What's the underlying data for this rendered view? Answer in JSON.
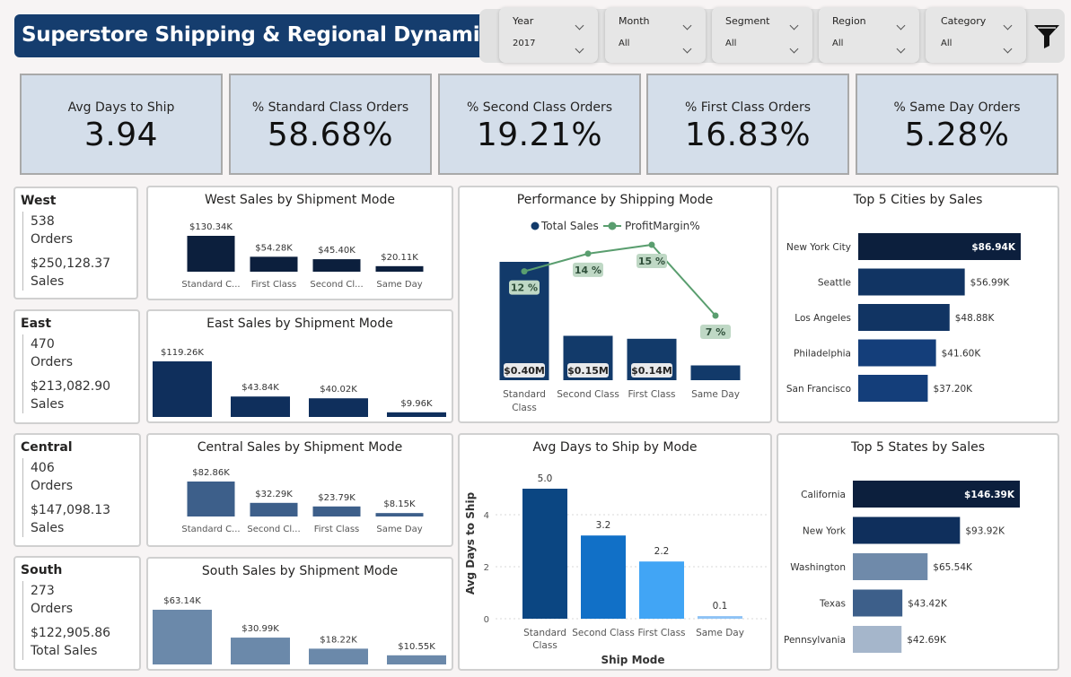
{
  "header": {
    "title": "Superstore Shipping & Regional Dynamics"
  },
  "slicers": [
    {
      "label": "Year",
      "value": "2017"
    },
    {
      "label": "Month",
      "value": "All"
    },
    {
      "label": "Segment",
      "value": "All"
    },
    {
      "label": "Region",
      "value": "All"
    },
    {
      "label": "Category",
      "value": "All"
    }
  ],
  "icons": {
    "filter": "funnel-icon"
  },
  "kpis": [
    {
      "label": "Avg Days to Ship",
      "value": "3.94"
    },
    {
      "label": "% Standard Class Orders",
      "value": "58.68%"
    },
    {
      "label": "% Second Class Orders",
      "value": "19.21%"
    },
    {
      "label": "% First Class Orders",
      "value": "16.83%"
    },
    {
      "label": "% Same Day Orders",
      "value": "5.28%"
    }
  ],
  "regions": [
    {
      "name": "West",
      "orders": "538",
      "orders_label": "Orders",
      "sales": "$250,128.37",
      "sales_label": "Sales"
    },
    {
      "name": "East",
      "orders": "470",
      "orders_label": "Orders",
      "sales": "$213,082.90",
      "sales_label": "Sales"
    },
    {
      "name": "Central",
      "orders": "406",
      "orders_label": "Orders",
      "sales": "$147,098.13",
      "sales_label": "Sales"
    },
    {
      "name": "South",
      "orders": "273",
      "orders_label": "Orders",
      "sales": "$122,905.86",
      "sales_label": "Total Sales"
    }
  ],
  "colors": {
    "title_bg": "#153d6e",
    "kpi_bg": "#d4deea",
    "west_bar": "#0c1f3d",
    "east_bar": "#0f2f5c",
    "central_bar": "#3d5f8a",
    "south_bar": "#6b89aa",
    "profit_line": "#5a9e6f",
    "perf_bar": "#123a6a"
  },
  "chart_data": [
    {
      "id": "west",
      "type": "bar",
      "title": "West Sales by Shipment Mode",
      "categories": [
        "Standard C...",
        "First Class",
        "Second Cl...",
        "Same Day"
      ],
      "values": [
        130.34,
        54.28,
        45.4,
        20.11
      ],
      "labels": [
        "$130.34K",
        "$54.28K",
        "$45.40K",
        "$20.11K"
      ],
      "ylim": [
        0,
        130.34
      ]
    },
    {
      "id": "east",
      "type": "bar",
      "title": "East Sales by Shipment Mode",
      "categories": [],
      "values": [
        119.26,
        43.84,
        40.02,
        9.96
      ],
      "labels": [
        "$119.26K",
        "$43.84K",
        "$40.02K",
        "$9.96K"
      ],
      "ylim": [
        0,
        119.26
      ]
    },
    {
      "id": "central",
      "type": "bar",
      "title": "Central Sales by Shipment Mode",
      "categories": [
        "Standard C...",
        "Second Cl...",
        "First Class",
        "Same Day"
      ],
      "values": [
        82.86,
        32.29,
        23.79,
        8.15
      ],
      "labels": [
        "$82.86K",
        "$32.29K",
        "$23.79K",
        "$8.15K"
      ],
      "ylim": [
        0,
        82.86
      ]
    },
    {
      "id": "south",
      "type": "bar",
      "title": "South Sales by Shipment Mode",
      "categories": [],
      "values": [
        63.14,
        30.99,
        18.22,
        10.55
      ],
      "labels": [
        "$63.14K",
        "$30.99K",
        "$18.22K",
        "$10.55K"
      ],
      "ylim": [
        0,
        63.14
      ]
    },
    {
      "id": "performance",
      "type": "bar",
      "title": "Performance by Shipping Mode",
      "categories": [
        "Standard Class",
        "Second Class",
        "First Class",
        "Same Day"
      ],
      "series": [
        {
          "name": "Total Sales",
          "values": [
            0.4,
            0.15,
            0.14,
            0.05
          ],
          "labels": [
            "$0.40M",
            "$0.15M",
            "$0.14M",
            ""
          ]
        },
        {
          "name": "ProfitMargin%",
          "values": [
            12,
            14,
            15,
            7
          ],
          "labels": [
            "12 %",
            "14 %",
            "15 %",
            "7 %"
          ]
        }
      ],
      "legend": "top-center"
    },
    {
      "id": "avgdays",
      "type": "bar",
      "title": "Avg Days to Ship by Mode",
      "categories": [
        "Standard Class",
        "Second Class",
        "First Class",
        "Same Day"
      ],
      "values": [
        5.0,
        3.2,
        2.2,
        0.1
      ],
      "labels": [
        "5.0",
        "3.2",
        "2.2",
        "0.1"
      ],
      "colors": [
        "#0b4682",
        "#1170c7",
        "#41a5f5",
        "#8ec3f5"
      ],
      "xlabel": "Ship Mode",
      "ylabel": "Avg Days to Ship",
      "yticks": [
        0,
        2,
        4
      ],
      "ylim": [
        0,
        5.0
      ],
      "grid": true
    },
    {
      "id": "cities",
      "type": "bar",
      "orientation": "horizontal",
      "title": "Top 5 Cities by Sales",
      "categories": [
        "New York City",
        "Seattle",
        "Los Angeles",
        "Philadelphia",
        "San Francisco"
      ],
      "values": [
        86.94,
        56.99,
        48.88,
        41.6,
        37.2
      ],
      "labels": [
        "$86.94K",
        "$56.99K",
        "$48.88K",
        "$41.60K",
        "$37.20K"
      ],
      "colors": [
        "#0c1f3d",
        "#113463",
        "#113463",
        "#143e7a",
        "#143e7a"
      ],
      "xlim": [
        0,
        86.94
      ]
    },
    {
      "id": "states",
      "type": "bar",
      "orientation": "horizontal",
      "title": "Top 5 States by Sales",
      "categories": [
        "California",
        "New York",
        "Washington",
        "Texas",
        "Pennsylvania"
      ],
      "values": [
        146.39,
        93.92,
        65.54,
        43.42,
        42.69
      ],
      "labels": [
        "$146.39K",
        "$93.92K",
        "$65.54K",
        "$43.42K",
        "$42.69K"
      ],
      "colors": [
        "#0c1f3d",
        "#0f2f5c",
        "#6f8aaa",
        "#3d5f8a",
        "#a5b6cb"
      ],
      "xlim": [
        0,
        146.39
      ]
    }
  ]
}
